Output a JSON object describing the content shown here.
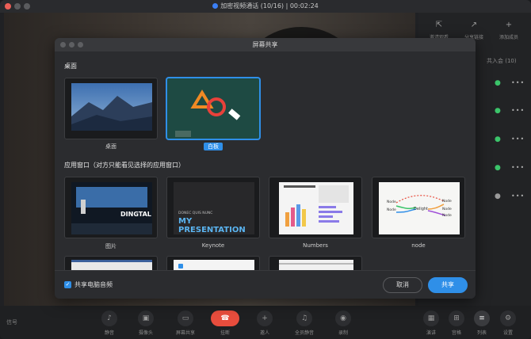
{
  "window": {
    "title": "加密视频通话 (10/16) | 00:02:24",
    "title_icon": "shield-icon"
  },
  "right_panel": {
    "tools": [
      {
        "label": "邀请观看",
        "icon": "invite-icon"
      },
      {
        "label": "分享链接",
        "icon": "share-link-icon"
      },
      {
        "label": "添加成员",
        "icon": "add-member-icon"
      }
    ],
    "participant_count": "共入会 (10)",
    "mic_icons": [
      "mic-icon",
      "mic-icon",
      "mic-icon",
      "mic-icon",
      "mic-icon"
    ],
    "more_label": "•••"
  },
  "dialog": {
    "title": "屏幕共享",
    "desktop_section": "桌面",
    "app_section": "应用窗口（对方只能看见选择的应用窗口）",
    "desktop_items": [
      {
        "label": "桌面",
        "selected": false
      },
      {
        "label": "白板",
        "selected": true
      }
    ],
    "app_items": [
      {
        "label": "图片",
        "caption": "DINGTAL"
      },
      {
        "label": "Keynote",
        "caption_small": "DONEC QUIS NUNC",
        "caption_big": "MY PRESENTATION"
      },
      {
        "label": "Numbers"
      },
      {
        "label": "node",
        "caption_center": "Delight",
        "node_label": "Node"
      }
    ],
    "bottom_row_count": 3,
    "audio_checkbox_label": "共享电脑音频",
    "audio_checked": true,
    "cancel_label": "取消",
    "share_label": "共享"
  },
  "bottom_bar": {
    "signal": "信号",
    "tools": [
      {
        "label": "静音",
        "icon": "mic-icon"
      },
      {
        "label": "摄像头",
        "icon": "camera-icon"
      },
      {
        "label": "屏幕共享",
        "icon": "screen-share-icon"
      },
      {
        "label": "挂断",
        "icon": "hangup-icon"
      },
      {
        "label": "邀人",
        "icon": "invite-icon"
      },
      {
        "label": "全员静音",
        "icon": "mute-all-icon"
      },
      {
        "label": "录制",
        "icon": "record-icon"
      }
    ],
    "view_tools": [
      {
        "label": "演讲",
        "icon": "speaker-view-icon"
      },
      {
        "label": "宫格",
        "icon": "grid-view-icon"
      },
      {
        "label": "列表",
        "icon": "list-view-icon"
      },
      {
        "label": "设置",
        "icon": "settings-icon"
      }
    ]
  },
  "colors": {
    "accent": "#2f8fe8",
    "hangup": "#e84d3d",
    "mic_active": "#3bc46a"
  }
}
